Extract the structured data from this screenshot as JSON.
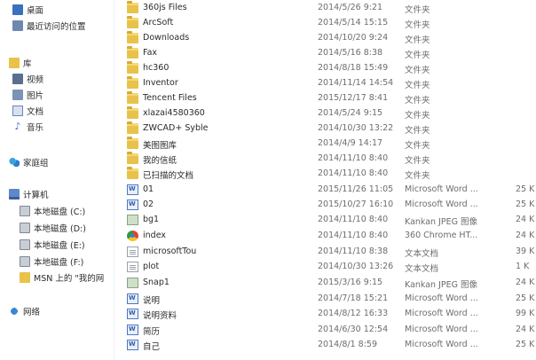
{
  "nav": [
    {
      "label": "桌面",
      "icon": "desktop-icon",
      "level": 1
    },
    {
      "label": "最近访问的位置",
      "icon": "recent-places-icon",
      "level": 1
    },
    {
      "label": "库",
      "icon": "library-icon",
      "level": 0
    },
    {
      "label": "视频",
      "icon": "video-icon",
      "level": 1
    },
    {
      "label": "图片",
      "icon": "pictures-icon",
      "level": 1
    },
    {
      "label": "文档",
      "icon": "documents-icon",
      "level": 1
    },
    {
      "label": "音乐",
      "icon": "music-icon",
      "level": 1
    },
    {
      "label": "家庭组",
      "icon": "homegroup-icon",
      "level": 0
    },
    {
      "label": "计算机",
      "icon": "computer-icon",
      "level": 0
    },
    {
      "label": "本地磁盘 (C:)",
      "icon": "drive-icon",
      "level": 2
    },
    {
      "label": "本地磁盘 (D:)",
      "icon": "drive-icon",
      "level": 2
    },
    {
      "label": "本地磁盘 (E:)",
      "icon": "drive-icon",
      "level": 2
    },
    {
      "label": "本地磁盘 (F:)",
      "icon": "drive-icon",
      "level": 2
    },
    {
      "label": "MSN 上的 \"我的网",
      "icon": "folder-icon",
      "level": 2
    },
    {
      "label": "网络",
      "icon": "network-icon",
      "level": 0
    }
  ],
  "files": [
    {
      "name": "360js Files",
      "date": "2014/5/26 9:21",
      "type": "文件夹",
      "size": "",
      "icon": "folder"
    },
    {
      "name": "ArcSoft",
      "date": "2014/5/14 15:15",
      "type": "文件夹",
      "size": "",
      "icon": "folder"
    },
    {
      "name": "Downloads",
      "date": "2014/10/20 9:24",
      "type": "文件夹",
      "size": "",
      "icon": "folder"
    },
    {
      "name": "Fax",
      "date": "2014/5/16 8:38",
      "type": "文件夹",
      "size": "",
      "icon": "folder"
    },
    {
      "name": "hc360",
      "date": "2014/8/18 15:49",
      "type": "文件夹",
      "size": "",
      "icon": "folder"
    },
    {
      "name": "Inventor",
      "date": "2014/11/14 14:54",
      "type": "文件夹",
      "size": "",
      "icon": "folder"
    },
    {
      "name": "Tencent Files",
      "date": "2015/12/17 8:41",
      "type": "文件夹",
      "size": "",
      "icon": "folder"
    },
    {
      "name": "xlazai4580360",
      "date": "2014/5/24 9:15",
      "type": "文件夹",
      "size": "",
      "icon": "folder"
    },
    {
      "name": "ZWCAD+ Syble",
      "date": "2014/10/30 13:22",
      "type": "文件夹",
      "size": "",
      "icon": "folder"
    },
    {
      "name": "美图图库",
      "date": "2014/4/9 14:17",
      "type": "文件夹",
      "size": "",
      "icon": "folder"
    },
    {
      "name": "我的信纸",
      "date": "2014/11/10 8:40",
      "type": "文件夹",
      "size": "",
      "icon": "folder"
    },
    {
      "name": "已扫描的文档",
      "date": "2014/11/10 8:40",
      "type": "文件夹",
      "size": "",
      "icon": "folder"
    },
    {
      "name": "01",
      "date": "2015/11/26 11:05",
      "type": "Microsoft Word ...",
      "size": "25 K",
      "icon": "doc"
    },
    {
      "name": "02",
      "date": "2015/10/27 16:10",
      "type": "Microsoft Word ...",
      "size": "25 K",
      "icon": "doc"
    },
    {
      "name": "bg1",
      "date": "2014/11/10 8:40",
      "type": "Kankan JPEG 图像",
      "size": "24 K",
      "icon": "img"
    },
    {
      "name": "index",
      "date": "2014/11/10 8:40",
      "type": "360 Chrome HT...",
      "size": "24 K",
      "icon": "html"
    },
    {
      "name": "microsoftTou",
      "date": "2014/11/10 8:38",
      "type": "文本文档",
      "size": "39 K",
      "icon": "txt"
    },
    {
      "name": "plot",
      "date": "2014/10/30 13:26",
      "type": "文本文档",
      "size": "1 K",
      "icon": "txt"
    },
    {
      "name": "Snap1",
      "date": "2015/3/16 9:15",
      "type": "Kankan JPEG 图像",
      "size": "24 K",
      "icon": "img"
    },
    {
      "name": "说明",
      "date": "2014/7/18 15:21",
      "type": "Microsoft Word ...",
      "size": "25 K",
      "icon": "doc"
    },
    {
      "name": "说明资料",
      "date": "2014/8/12 16:33",
      "type": "Microsoft Word ...",
      "size": "99 K",
      "icon": "doc"
    },
    {
      "name": "简历",
      "date": "2014/6/30 12:54",
      "type": "Microsoft Word ...",
      "size": "24 K",
      "icon": "doc"
    },
    {
      "name": "自己",
      "date": "2014/8/1 8:59",
      "type": "Microsoft Word ...",
      "size": "25 K",
      "icon": "doc"
    }
  ]
}
